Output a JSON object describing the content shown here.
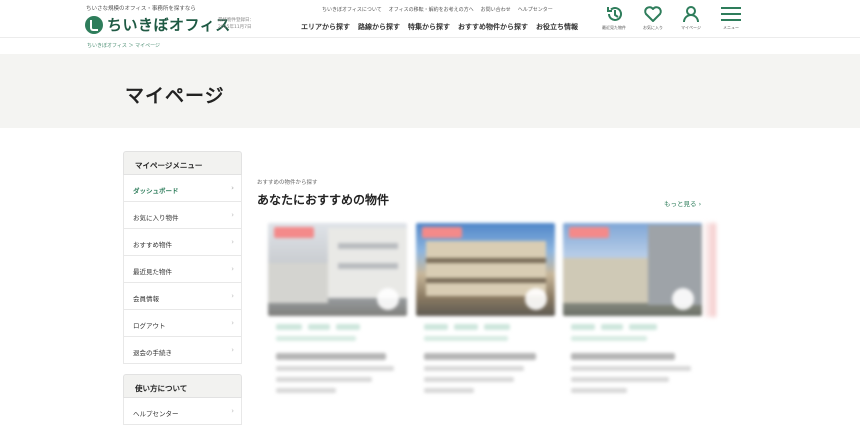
{
  "header": {
    "tagline": "ちいさな規模のオフィス・事務所を探すなら",
    "logo_text": "ちいきぼオフィス",
    "last_updated_label": "最終物件登録日：",
    "last_updated_date": "2025年11月7日",
    "utility_links": [
      "ちいきぼオフィスについて",
      "オフィスの移転・解約をお考えの方へ",
      "お問い合わせ",
      "ヘルプセンター"
    ],
    "nav_items": [
      "エリアから探す",
      "路線から探す",
      "特集から探す",
      "おすすめ物件から探す",
      "お役立ち情報"
    ],
    "icons": [
      {
        "name": "history-icon",
        "label": "最近見た物件"
      },
      {
        "name": "heart-icon",
        "label": "お気に入り"
      },
      {
        "name": "user-icon",
        "label": "マイページ"
      },
      {
        "name": "menu-icon",
        "label": "メニュー"
      }
    ]
  },
  "breadcrumb": "ちいきぼオフィス ＞ マイページ",
  "page_title": "マイページ",
  "sidebar": {
    "menu_title": "マイページメニュー",
    "items": [
      {
        "label": "ダッシュボード",
        "active": true
      },
      {
        "label": "お気に入り物件",
        "active": false
      },
      {
        "label": "おすすめ物件",
        "active": false
      },
      {
        "label": "最近見た物件",
        "active": false
      },
      {
        "label": "会員情報",
        "active": false
      },
      {
        "label": "ログアウト",
        "active": false
      },
      {
        "label": "退会の手続き",
        "active": false
      }
    ],
    "usage_title": "使い方について",
    "usage_items": [
      {
        "label": "ヘルプセンター"
      }
    ],
    "chevron": "›"
  },
  "recommend": {
    "kicker": "おすすめの物件から探す",
    "title": "あなたにおすすめの物件",
    "more_label": "もっと見る ›"
  },
  "colors": {
    "brand": "#2e7d5b",
    "badge": "#f48a8a",
    "title_band": "#f4f4f2"
  }
}
